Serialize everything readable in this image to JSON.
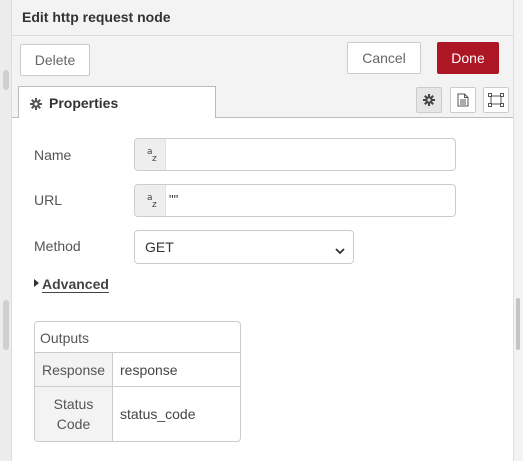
{
  "tray": {
    "title": "Edit http request node"
  },
  "toolbar": {
    "delete_label": "Delete",
    "cancel_label": "Cancel",
    "done_label": "Done"
  },
  "colors": {
    "done_button": "#ad1625",
    "header_bg": "#f3f3f3",
    "border": "#cccccc"
  },
  "tabs": {
    "active_label": "Properties",
    "icons": [
      "gear-icon",
      "description-icon",
      "appearance-icon"
    ]
  },
  "form": {
    "name": {
      "label": "Name",
      "type_glyph": {
        "top": "a",
        "bottom": "z"
      },
      "value": ""
    },
    "url": {
      "label": "URL",
      "type_glyph": {
        "top": "a",
        "bottom": "z"
      },
      "value": "\"\""
    },
    "method": {
      "label": "Method",
      "selected": "GET"
    },
    "advanced": {
      "label": "Advanced"
    }
  },
  "outputs": {
    "header": "Outputs",
    "rows": [
      {
        "key": "Response",
        "value": "response"
      },
      {
        "key": "Status Code",
        "value": "status_code"
      }
    ]
  }
}
